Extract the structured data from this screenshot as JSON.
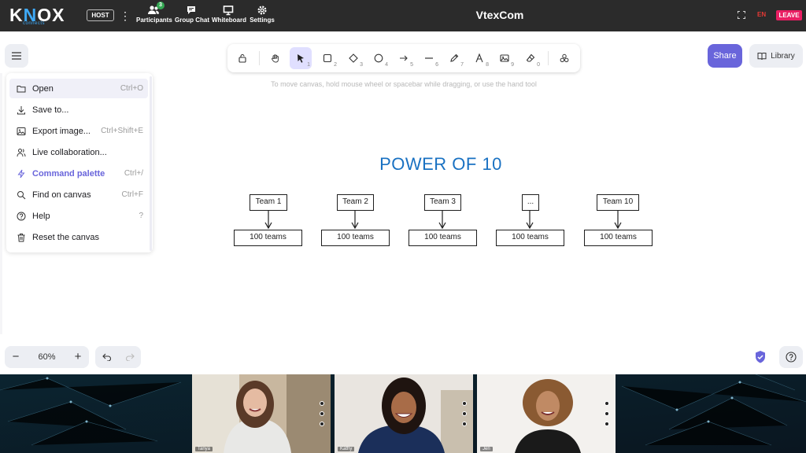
{
  "topbar": {
    "logo": "KNOX",
    "logo_sub": "connects",
    "host_badge": "HOST",
    "kebab": "⋮",
    "nav": [
      {
        "label": "Participants",
        "icon": "participants-icon",
        "count": "3"
      },
      {
        "label": "Group Chat",
        "icon": "chat-icon"
      },
      {
        "label": "Whiteboard",
        "icon": "whiteboard-icon"
      },
      {
        "label": "Settings",
        "icon": "settings-icon"
      }
    ],
    "title": "VtexCom",
    "language": "EN",
    "leave_label": "LEAVE"
  },
  "toolbar": {
    "tools": [
      {
        "name": "lock",
        "icon": "lock-icon",
        "shortcut": ""
      },
      {
        "name": "hand",
        "icon": "hand-icon",
        "shortcut": ""
      },
      {
        "name": "selection",
        "icon": "pointer-icon",
        "shortcut": "1",
        "active": true
      },
      {
        "name": "rectangle",
        "icon": "rectangle-icon",
        "shortcut": "2"
      },
      {
        "name": "diamond",
        "icon": "diamond-icon",
        "shortcut": "3"
      },
      {
        "name": "ellipse",
        "icon": "ellipse-icon",
        "shortcut": "4"
      },
      {
        "name": "arrow",
        "icon": "arrow-icon",
        "shortcut": "5"
      },
      {
        "name": "line",
        "icon": "line-icon",
        "shortcut": "6"
      },
      {
        "name": "draw",
        "icon": "pencil-icon",
        "shortcut": "7"
      },
      {
        "name": "text",
        "icon": "text-icon",
        "shortcut": "8"
      },
      {
        "name": "image",
        "icon": "image-icon",
        "shortcut": "9"
      },
      {
        "name": "eraser",
        "icon": "eraser-icon",
        "shortcut": "0"
      },
      {
        "name": "more",
        "icon": "shapes-icon",
        "shortcut": ""
      }
    ],
    "hint": "To move canvas, hold mouse wheel or spacebar while dragging, or use the hand tool"
  },
  "actions": {
    "share_label": "Share",
    "library_label": "Library"
  },
  "main_menu": {
    "items": [
      {
        "label": "Open",
        "shortcut": "Ctrl+O",
        "icon": "folder-icon"
      },
      {
        "label": "Save to...",
        "shortcut": "",
        "icon": "download-icon"
      },
      {
        "label": "Export image...",
        "shortcut": "Ctrl+Shift+E",
        "icon": "image-export-icon"
      },
      {
        "label": "Live collaboration...",
        "shortcut": "",
        "icon": "users-icon"
      },
      {
        "label": "Command palette",
        "shortcut": "Ctrl+/",
        "icon": "bolt-icon"
      },
      {
        "label": "Find on canvas",
        "shortcut": "Ctrl+F",
        "icon": "search-icon"
      },
      {
        "label": "Help",
        "shortcut": "?",
        "icon": "help-icon"
      },
      {
        "label": "Reset the canvas",
        "shortcut": "",
        "icon": "trash-icon"
      }
    ]
  },
  "diagram": {
    "title": "POWER OF 10",
    "teams": [
      "Team 1",
      "Team 2",
      "Team 3",
      "...",
      "Team 10"
    ],
    "children": [
      "100 teams",
      "100 teams",
      "100 teams",
      "100 teams",
      "100 teams"
    ]
  },
  "footer": {
    "zoom": "60%"
  },
  "participants": [
    {
      "name": "Tanya"
    },
    {
      "name": "Kathy"
    },
    {
      "name": "Jen"
    }
  ],
  "colors": {
    "accent": "#6965db",
    "title_blue": "#1971c2",
    "leave": "#e91e63",
    "topbar": "#2b2b2b"
  }
}
